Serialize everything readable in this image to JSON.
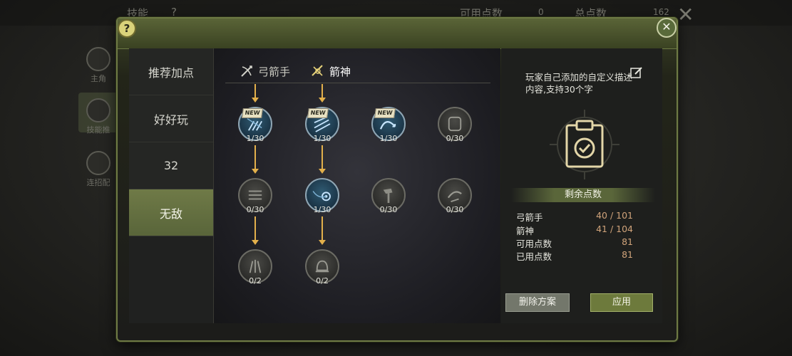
{
  "background": {
    "title": "技能",
    "available_points_label": "可用点数",
    "available_points_value": "0",
    "total_points_label": "总点数",
    "total_points_value": "162",
    "side_items": [
      "主角",
      "技能推",
      "连招配"
    ]
  },
  "dialog": {
    "help_label": "?",
    "close_label": "✕"
  },
  "presets": [
    {
      "label": "推荐加点"
    },
    {
      "label": "好好玩"
    },
    {
      "label": "32"
    },
    {
      "label": "无敌"
    }
  ],
  "class_tabs": [
    {
      "label": "弓箭手",
      "icon": "bow-icon"
    },
    {
      "label": "箭神",
      "icon": "arrow-god-icon"
    }
  ],
  "skills": [
    {
      "level": "1/30",
      "new": true,
      "icon": "arrow-rain-icon",
      "learned": true
    },
    {
      "level": "1/30",
      "new": true,
      "icon": "multi-arrow-icon",
      "learned": true
    },
    {
      "level": "1/30",
      "new": true,
      "icon": "arc-shot-icon",
      "learned": true
    },
    {
      "level": "0/30",
      "new": false,
      "icon": "gate-icon",
      "learned": false
    },
    {
      "level": "0/30",
      "new": false,
      "icon": "volley-icon",
      "learned": false
    },
    {
      "level": "1/30",
      "new": false,
      "icon": "target-shot-icon",
      "learned": true
    },
    {
      "level": "0/30",
      "new": false,
      "icon": "hammer-icon",
      "learned": false
    },
    {
      "level": "0/30",
      "new": false,
      "icon": "dash-icon",
      "learned": false
    },
    {
      "level": "0/2",
      "new": false,
      "icon": "pillar-icon",
      "learned": false
    },
    {
      "level": "0/2",
      "new": false,
      "icon": "bell-icon",
      "learned": false
    }
  ],
  "new_badge": "NEW",
  "right_panel": {
    "description": "玩家自己添加的自定义描述内容,支持30个字",
    "edit_icon": "edit-icon",
    "remaining_title": "剩余点数",
    "stats": [
      {
        "label": "弓箭手",
        "value": "40 / 101"
      },
      {
        "label": "箭神",
        "value": "41 / 104"
      },
      {
        "label": "可用点数",
        "value": "81"
      },
      {
        "label": "已用点数",
        "value": "81"
      }
    ],
    "delete_label": "删除方案",
    "apply_label": "应用"
  },
  "colors": {
    "accent_green": "#6d7a3c",
    "arrow_gold": "#e3b04b",
    "points_value": "#d0a37a"
  }
}
